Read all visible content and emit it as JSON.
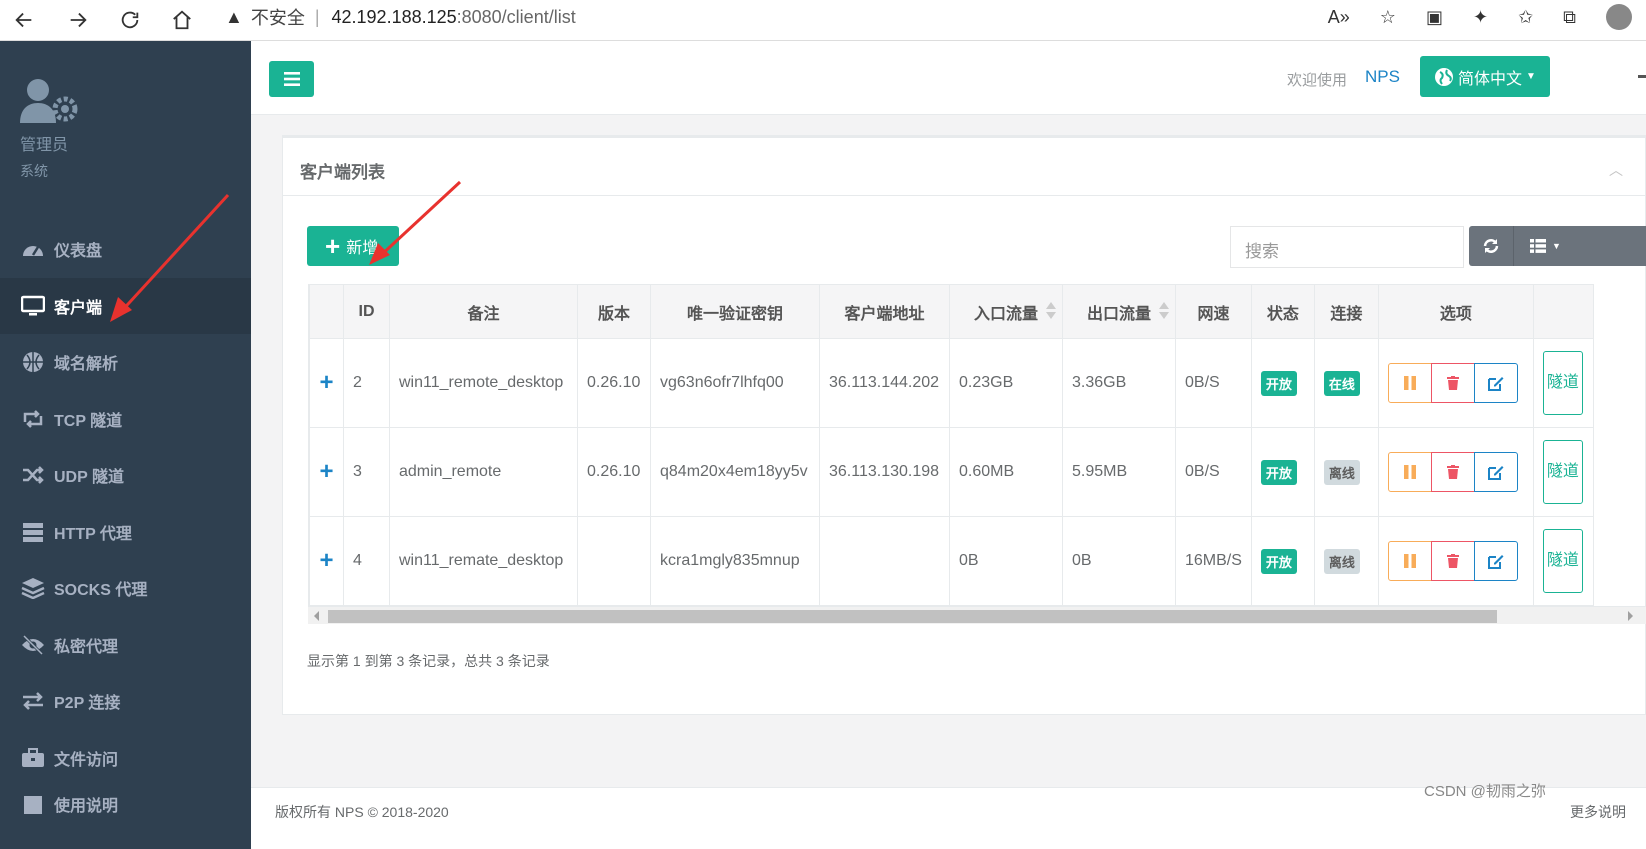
{
  "browser": {
    "security_label": "不安全",
    "url_host": "42.192.188.125",
    "url_path": ":8080/client/list"
  },
  "sidebar": {
    "user_name": "管理员",
    "user_role": "系统",
    "items": [
      {
        "label": "仪表盘",
        "icon": "dashboard-icon"
      },
      {
        "label": "客户端",
        "icon": "desktop-icon"
      },
      {
        "label": "域名解析",
        "icon": "globe-icon"
      },
      {
        "label": "TCP 隧道",
        "icon": "retweet-icon"
      },
      {
        "label": "UDP 隧道",
        "icon": "random-icon"
      },
      {
        "label": "HTTP 代理",
        "icon": "server-icon"
      },
      {
        "label": "SOCKS 代理",
        "icon": "layers-icon"
      },
      {
        "label": "私密代理",
        "icon": "eye-slash-icon"
      },
      {
        "label": "P2P 连接",
        "icon": "exchange-icon"
      },
      {
        "label": "文件访问",
        "icon": "briefcase-icon"
      },
      {
        "label": "使用说明",
        "icon": "book-icon"
      }
    ]
  },
  "topnav": {
    "welcome": "欢迎使用",
    "brand": "NPS",
    "language": "简体中文"
  },
  "panel": {
    "title": "客户端列表",
    "add_label": "新增",
    "search_placeholder": "搜索"
  },
  "table": {
    "headers": [
      "ID",
      "备注",
      "版本",
      "唯一验证密钥",
      "客户端地址",
      "入口流量",
      "出口流量",
      "网速",
      "状态",
      "连接",
      "选项"
    ],
    "rows": [
      {
        "id": "2",
        "remark": "win11_remote_desktop",
        "version": "0.26.10",
        "key": "vg63n6ofr7lhfq00",
        "addr": "36.113.144.202",
        "in": "0.23GB",
        "out": "3.36GB",
        "speed": "0B/S",
        "status": "开放",
        "conn": "在线",
        "tunnel": "隧道"
      },
      {
        "id": "3",
        "remark": "admin_remote",
        "version": "0.26.10",
        "key": "q84m20x4em18yy5v",
        "addr": "36.113.130.198",
        "in": "0.60MB",
        "out": "5.95MB",
        "speed": "0B/S",
        "status": "开放",
        "conn": "离线",
        "tunnel": "隧道"
      },
      {
        "id": "4",
        "remark": "win11_remate_desktop",
        "version": "",
        "key": "kcra1mgly835mnup",
        "addr": "",
        "in": "0B",
        "out": "0B",
        "speed": "16MB/S",
        "status": "开放",
        "conn": "离线",
        "tunnel": "隧道"
      }
    ],
    "summary": "显示第 1 到第 3 条记录，总共 3 条记录"
  },
  "footer": {
    "left": "版权所有 NPS © 2018-2020",
    "right": "更多说明"
  },
  "watermark": "CSDN @韧雨之弥",
  "colors": {
    "sidebar": "#2f4050",
    "primary": "#1ab394",
    "link": "#1c84c6",
    "warning": "#f8ac59",
    "danger": "#ed5565",
    "annotation_arrow": "#e8322e"
  }
}
